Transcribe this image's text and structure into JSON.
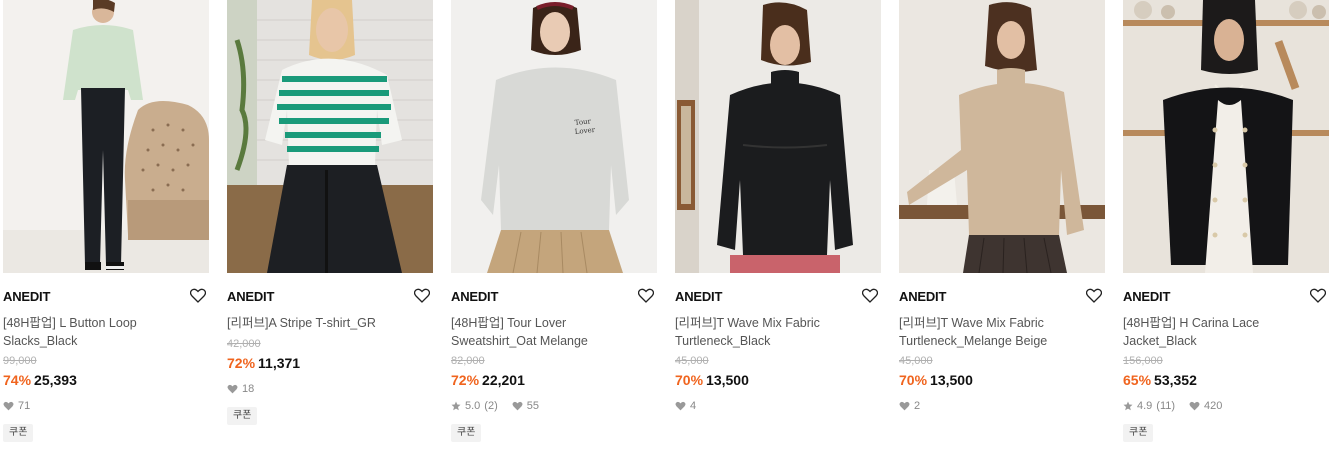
{
  "products": [
    {
      "brand": "ANEDIT",
      "name": "[48H팝업] L Button Loop Slacks_Black",
      "original_price": "99,000",
      "discount": "74%",
      "price": "25,393",
      "likes": "71",
      "coupon": "쿠폰",
      "image_desc": "mint-shirt-black-slacks"
    },
    {
      "brand": "ANEDIT",
      "name": "[리퍼브]A Stripe T-shirt_GR",
      "original_price": "42,000",
      "discount": "72%",
      "price": "11,371",
      "likes": "18",
      "coupon": "쿠폰",
      "image_desc": "green-stripe-tshirt"
    },
    {
      "brand": "ANEDIT",
      "name": "[48H팝업] Tour Lover Sweatshirt_Oat Melange",
      "original_price": "82,000",
      "discount": "72%",
      "price": "22,201",
      "rating": "5.0",
      "reviews": "(2)",
      "likes": "55",
      "coupon": "쿠폰",
      "image_desc": "oat-melange-sweatshirt"
    },
    {
      "brand": "ANEDIT",
      "name": "[리퍼브]T Wave Mix Fabric Turtleneck_Black",
      "original_price": "45,000",
      "discount": "70%",
      "price": "13,500",
      "likes": "4",
      "image_desc": "black-turtleneck"
    },
    {
      "brand": "ANEDIT",
      "name": "[리퍼브]T Wave Mix Fabric Turtleneck_Melange Beige",
      "original_price": "45,000",
      "discount": "70%",
      "price": "13,500",
      "likes": "2",
      "image_desc": "beige-turtleneck"
    },
    {
      "brand": "ANEDIT",
      "name": "[48H팝업] H Carina Lace Jacket_Black",
      "original_price": "156,000",
      "discount": "65%",
      "price": "53,352",
      "rating": "4.9",
      "reviews": "(11)",
      "likes": "420",
      "coupon": "쿠폰",
      "image_desc": "black-lace-jacket"
    }
  ],
  "colors": {
    "discount": "#f0641e",
    "text": "#111111",
    "muted": "#888888"
  }
}
